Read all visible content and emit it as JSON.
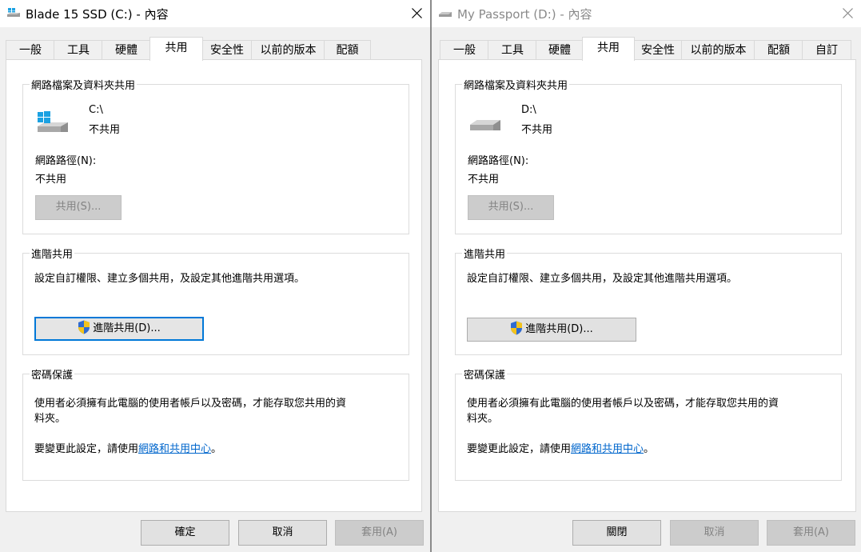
{
  "dialog1": {
    "title": "Blade 15 SSD (C:) - 內容",
    "tabs": [
      {
        "label": "一般"
      },
      {
        "label": "工具"
      },
      {
        "label": "硬體"
      },
      {
        "label": "共用"
      },
      {
        "label": "安全性"
      },
      {
        "label": "以前的版本"
      },
      {
        "label": "配額"
      }
    ],
    "active_tab": "共用",
    "network_sharing": {
      "title": "網路檔案及資料夾共用",
      "drive_name": "C:\\",
      "drive_status": "不共用",
      "path_label": "網路路徑(N):",
      "path_value": "不共用",
      "share_button": "共用(S)..."
    },
    "advanced_sharing": {
      "title": "進階共用",
      "description": "設定自訂權限、建立多個共用，及設定其他進階共用選項。",
      "button": "進階共用(D)..."
    },
    "password_protection": {
      "title": "密碼保護",
      "line1": "使用者必須擁有此電腦的使用者帳戶以及密碼，才能存取您共用的資",
      "line2": "料夾。",
      "change_prefix": "要變更此設定，請使用",
      "link": "網路和共用中心",
      "change_suffix": "。"
    },
    "buttons": {
      "ok": "確定",
      "cancel": "取消",
      "apply": "套用(A)"
    }
  },
  "dialog2": {
    "title": "My Passport (D:) - 內容",
    "tabs": [
      {
        "label": "一般"
      },
      {
        "label": "工具"
      },
      {
        "label": "硬體"
      },
      {
        "label": "共用"
      },
      {
        "label": "安全性"
      },
      {
        "label": "以前的版本"
      },
      {
        "label": "配額"
      },
      {
        "label": "自訂"
      }
    ],
    "active_tab": "共用",
    "network_sharing": {
      "title": "網路檔案及資料夾共用",
      "drive_name": "D:\\",
      "drive_status": "不共用",
      "path_label": "網路路徑(N):",
      "path_value": "不共用",
      "share_button": "共用(S)..."
    },
    "advanced_sharing": {
      "title": "進階共用",
      "description": "設定自訂權限、建立多個共用，及設定其他進階共用選項。",
      "button": "進階共用(D)..."
    },
    "password_protection": {
      "title": "密碼保護",
      "line1": "使用者必須擁有此電腦的使用者帳戶以及密碼，才能存取您共用的資",
      "line2": "料夾。",
      "change_prefix": "要變更此設定，請使用",
      "link": "網路和共用中心",
      "change_suffix": "。"
    },
    "buttons": {
      "close": "關閉",
      "cancel": "取消",
      "apply": "套用(A)"
    }
  },
  "colors": {
    "link": "#0066cc",
    "focus_border": "#0078d7",
    "disabled_text": "#838383",
    "windows_blue": "#1ba1e2"
  },
  "icons": [
    "windows-drive-icon",
    "external-drive-icon",
    "uac-shield-icon",
    "close-icon"
  ]
}
